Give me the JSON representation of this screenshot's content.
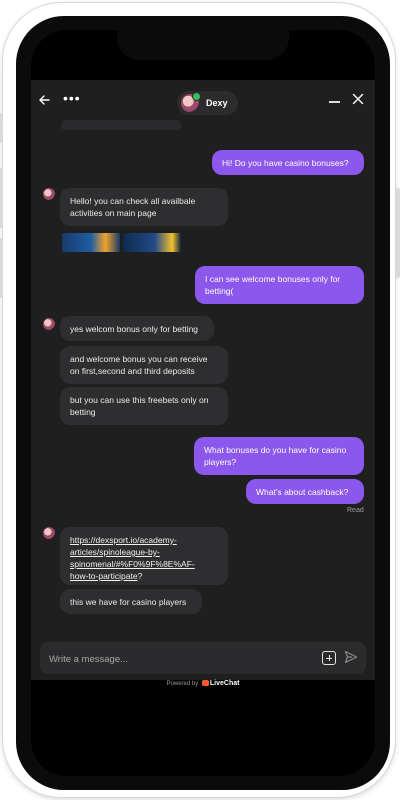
{
  "agent": {
    "name": "Dexy"
  },
  "messages": [
    {
      "from": "visitor",
      "text": "Hi! Do you have casino bonuses?"
    },
    {
      "from": "agent",
      "text": "Hello! you can check all availbale activities on main page"
    },
    {
      "from": "visitor",
      "text": "I can see welcome bonuses only for betting("
    },
    {
      "from": "agent",
      "text": "yes welcom bonus only for betting"
    },
    {
      "from": "agent",
      "text": "and welcome bonus you can receive on first,second and third deposits"
    },
    {
      "from": "agent",
      "text": "but you can use this freebets only on betting"
    },
    {
      "from": "visitor",
      "text": "What bonuses do you have for casino players?"
    },
    {
      "from": "visitor",
      "text": "What's about cashback?"
    },
    {
      "from": "agent",
      "link": "https://dexsport.io/academy-articles/spinoleague-by-spinomenal/#%F0%9F%8E%AF-how-to-participate",
      "link_line1": "https://dexsport.io/academy-",
      "link_line2": "articles/spinoleague-by-",
      "link_line3": "spinomenal/#%F0%9F%8E%AF-",
      "link_line4": "how-to-participate",
      "suffix": "?"
    },
    {
      "from": "agent",
      "text": "this we have for casino players"
    }
  ],
  "status": {
    "read": "Read"
  },
  "composer": {
    "placeholder": "Write a message..."
  },
  "footer": {
    "powered_by": "Powered by",
    "brand": "LiveChat"
  },
  "colors": {
    "visitor_bubble": "#8b57ec",
    "agent_bubble": "#2e2e30",
    "background": "#1f1f20"
  }
}
